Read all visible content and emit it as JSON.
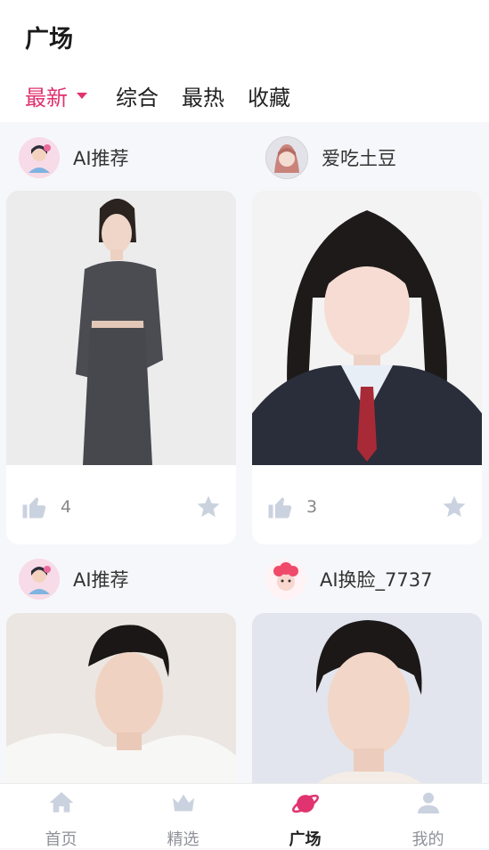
{
  "header": {
    "title": "广场",
    "tabs": [
      {
        "label": "最新",
        "active": true
      },
      {
        "label": "综合",
        "active": false
      },
      {
        "label": "最热",
        "active": false
      },
      {
        "label": "收藏",
        "active": false
      }
    ]
  },
  "posts": [
    {
      "author": "AI推荐",
      "likes": "4"
    },
    {
      "author": "爱吃土豆",
      "likes": "3"
    },
    {
      "author": "AI推荐"
    },
    {
      "author": "AI换脸_7737"
    }
  ],
  "navbar": {
    "items": [
      {
        "label": "首页",
        "icon": "home-icon"
      },
      {
        "label": "精选",
        "icon": "crown-icon"
      },
      {
        "label": "广场",
        "icon": "planet-icon",
        "active": true
      },
      {
        "label": "我的",
        "icon": "user-icon"
      }
    ]
  },
  "colors": {
    "accent": "#e0336f",
    "icon_gray": "#cbd2df",
    "background": "#f6f7fa"
  }
}
